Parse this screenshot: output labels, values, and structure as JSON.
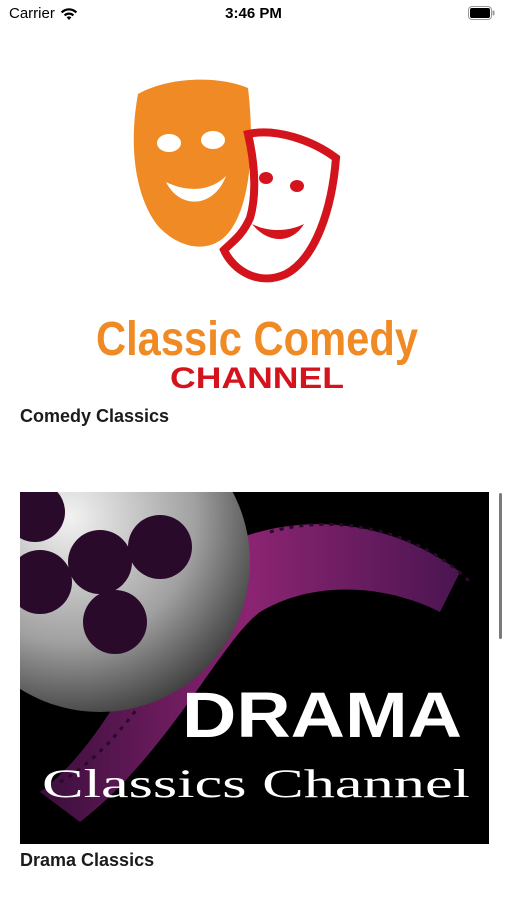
{
  "status_bar": {
    "carrier": "Carrier",
    "time": "3:46 PM"
  },
  "channels": [
    {
      "logo_text_line1": "Classic Comedy",
      "logo_text_line2": "CHANNEL",
      "title": "Comedy Classics"
    },
    {
      "logo_text_line1": "DRAMA",
      "logo_text_line2": "Classics Channel",
      "title": "Drama Classics"
    }
  ],
  "colors": {
    "comedy_orange": "#f08a24",
    "comedy_red": "#d4141c",
    "drama_purple": "#7a1f6e"
  }
}
